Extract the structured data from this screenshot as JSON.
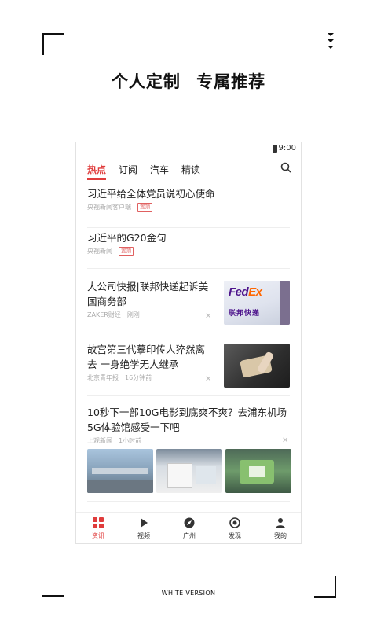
{
  "headline": {
    "left": "个人定制",
    "right": "专属推荐"
  },
  "footer": "WHITE VERSION",
  "status": {
    "time": "9:00"
  },
  "tabs": [
    {
      "label": "热点",
      "active": true
    },
    {
      "label": "订阅",
      "active": false
    },
    {
      "label": "汽车",
      "active": false
    },
    {
      "label": "精读",
      "active": false
    }
  ],
  "news": [
    {
      "title": "习近平给全体党员说初心使命",
      "source": "央视新闻客户端",
      "badge": "置顶"
    },
    {
      "title": "习近平的G20金句",
      "source": "央视新闻",
      "badge": "置顶"
    },
    {
      "title": "大公司快报|联邦快递起诉美国商务部",
      "source": "ZAKER财经",
      "time": "刚刚",
      "image_text": "FedEx 联邦快递"
    },
    {
      "title": "故宫第三代摹印传人猝然离去 一身绝学无人继承",
      "source": "北京青年报",
      "time": "16分钟前"
    },
    {
      "title": "10秒下一部10G电影到底爽不爽？去浦东机场5G体验馆感受一下吧",
      "source": "上观新闻",
      "time": "1小时前"
    }
  ],
  "bottom_nav": [
    {
      "label": "资讯",
      "icon": "grid-icon",
      "active": true
    },
    {
      "label": "视频",
      "icon": "play-icon",
      "active": false
    },
    {
      "label": "广州",
      "icon": "location-icon",
      "active": false
    },
    {
      "label": "发现",
      "icon": "discover-icon",
      "active": false
    },
    {
      "label": "我的",
      "icon": "user-icon",
      "active": false
    }
  ],
  "colors": {
    "accent": "#e03c3c",
    "fedex_purple": "#4d148c",
    "fedex_orange": "#ff6600"
  }
}
